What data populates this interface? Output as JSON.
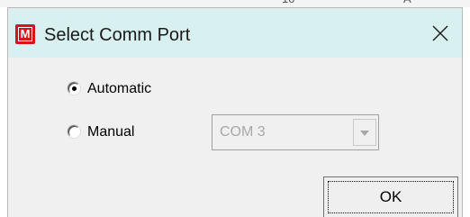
{
  "background": {
    "partial_text": "10",
    "partial_text_2": "A"
  },
  "window": {
    "title": "Select Comm Port",
    "icon": "app-m-icon",
    "icon_letter": "M",
    "close_icon": "close-icon",
    "colors": {
      "titlebar": "#d8f0f0",
      "body": "#f0f0f0",
      "icon": "#d7141a"
    }
  },
  "options": [
    {
      "label": "Automatic",
      "selected": true
    },
    {
      "label": "Manual",
      "selected": false
    }
  ],
  "port_select": {
    "value": "COM 3",
    "enabled": false,
    "arrow_icon": "chevron-down-icon"
  },
  "ok_button": {
    "label": "OK"
  }
}
